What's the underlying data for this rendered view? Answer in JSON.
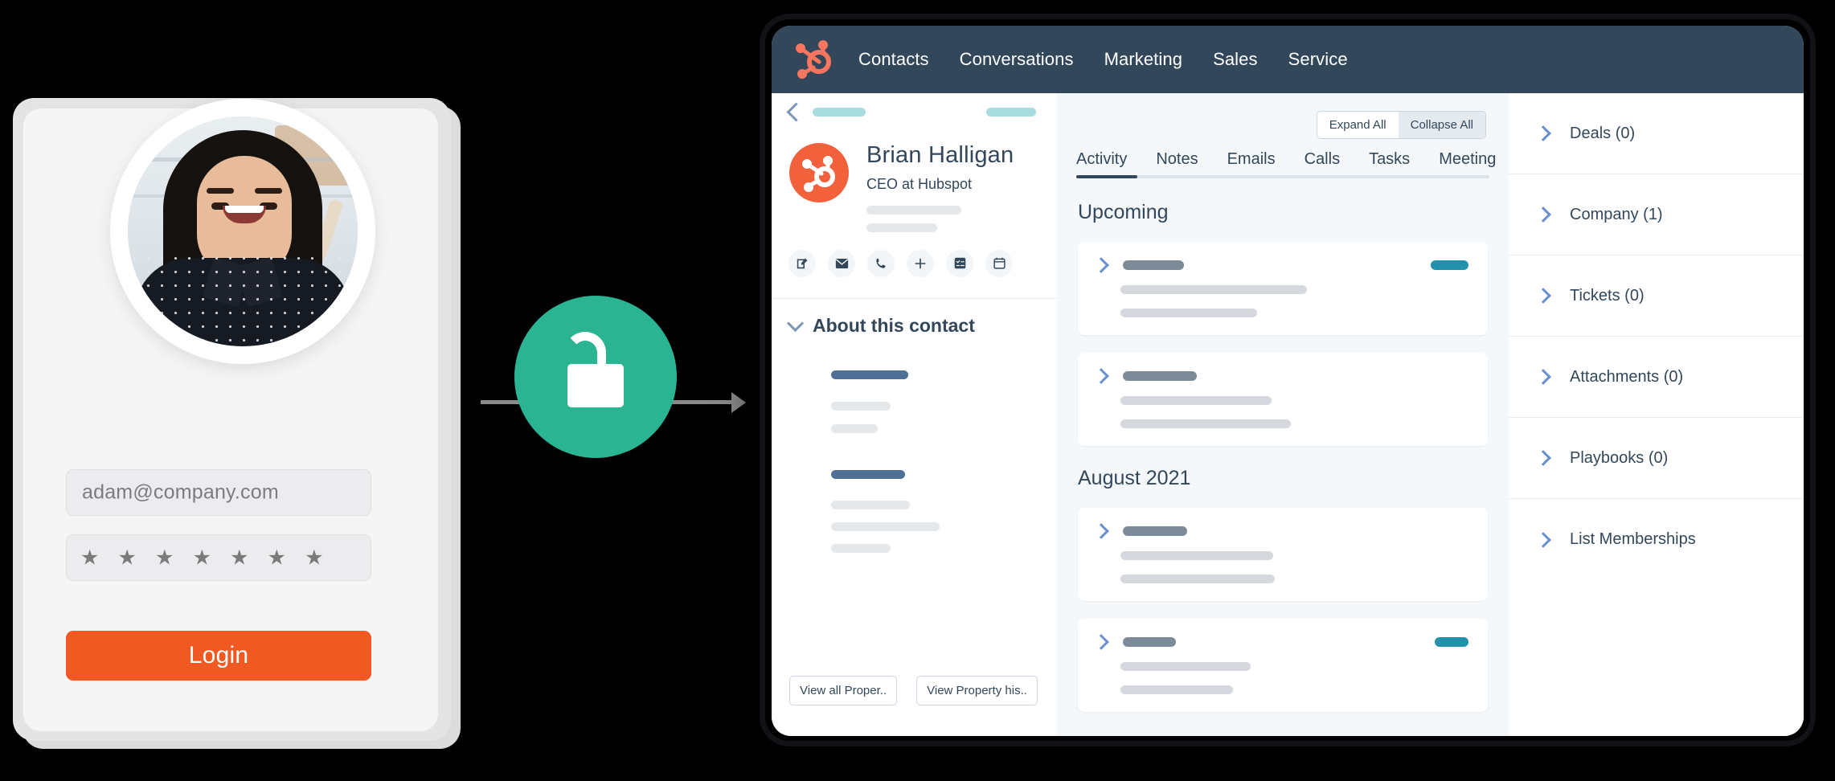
{
  "login": {
    "avatar_alt": "smiling-woman-portrait",
    "email_value": "adam@company.com",
    "email_placeholder": "adam@company.com",
    "password_mask": "★ ★ ★ ★ ★ ★ ★",
    "login_label": "Login"
  },
  "connector": {
    "badge_icon": "unlock-icon",
    "badge_color": "#2bb491",
    "wire_color": "#8a8a8a"
  },
  "crm": {
    "topnav": {
      "logo": "hubspot-sprocket-logo",
      "links": [
        "Contacts",
        "Conversations",
        "Marketing",
        "Sales",
        "Service"
      ],
      "bg": "#33475b"
    },
    "left_panel": {
      "back_icon": "chevron-left-icon",
      "contact_name": "Brian Halligan",
      "contact_role": "CEO at Hubspot",
      "avatar": "hubspot-sprocket-avatar",
      "action_icons": [
        "note-icon",
        "email-icon",
        "call-icon",
        "plus-icon",
        "task-icon",
        "meeting-icon"
      ],
      "about_title": "About this contact",
      "about_chevron": "chevron-down-icon",
      "footer_buttons": [
        "View all Proper..",
        "View Property his.."
      ]
    },
    "center_panel": {
      "expand_label": "Expand All",
      "collapse_label": "Collapse All",
      "tabs": [
        "Activity",
        "Notes",
        "Emails",
        "Calls",
        "Tasks",
        "Meeting"
      ],
      "active_tab": "Activity",
      "sections": [
        {
          "title": "Upcoming",
          "cards": [
            {
              "chevron": "chevron-right-icon",
              "title_w": 76,
              "badge_w": 47,
              "has_badge": true,
              "lines": [
                232,
                170
              ]
            },
            {
              "chevron": "chevron-right-icon",
              "title_w": 92,
              "badge_w": 0,
              "has_badge": false,
              "lines": [
                188,
                212
              ]
            }
          ]
        },
        {
          "title": "August 2021",
          "cards": [
            {
              "chevron": "chevron-right-icon",
              "title_w": 80,
              "badge_w": 0,
              "has_badge": false,
              "lines": [
                190,
                192
              ]
            },
            {
              "chevron": "chevron-right-icon",
              "title_w": 66,
              "badge_w": 42,
              "has_badge": true,
              "lines": [
                162,
                140
              ]
            }
          ]
        }
      ]
    },
    "right_panel": {
      "items": [
        {
          "label": "Deals (0)",
          "chevron": "chevron-right-icon"
        },
        {
          "label": "Company (1)",
          "chevron": "chevron-right-icon"
        },
        {
          "label": "Tickets (0)",
          "chevron": "chevron-right-icon"
        },
        {
          "label": "Attachments  (0)",
          "chevron": "chevron-right-icon"
        },
        {
          "label": "Playbooks (0)",
          "chevron": "chevron-right-icon"
        },
        {
          "label": "List Memberships",
          "chevron": "chevron-right-icon"
        }
      ]
    }
  },
  "colors": {
    "hubspot_orange": "#f2603c",
    "login_orange": "#f05a22",
    "navy": "#33475b",
    "teal_badge": "#2191ac",
    "unlock_green": "#2bb491",
    "skeleton_teal": "#a8dde0",
    "skeleton_gray": "#d5d8dc"
  }
}
